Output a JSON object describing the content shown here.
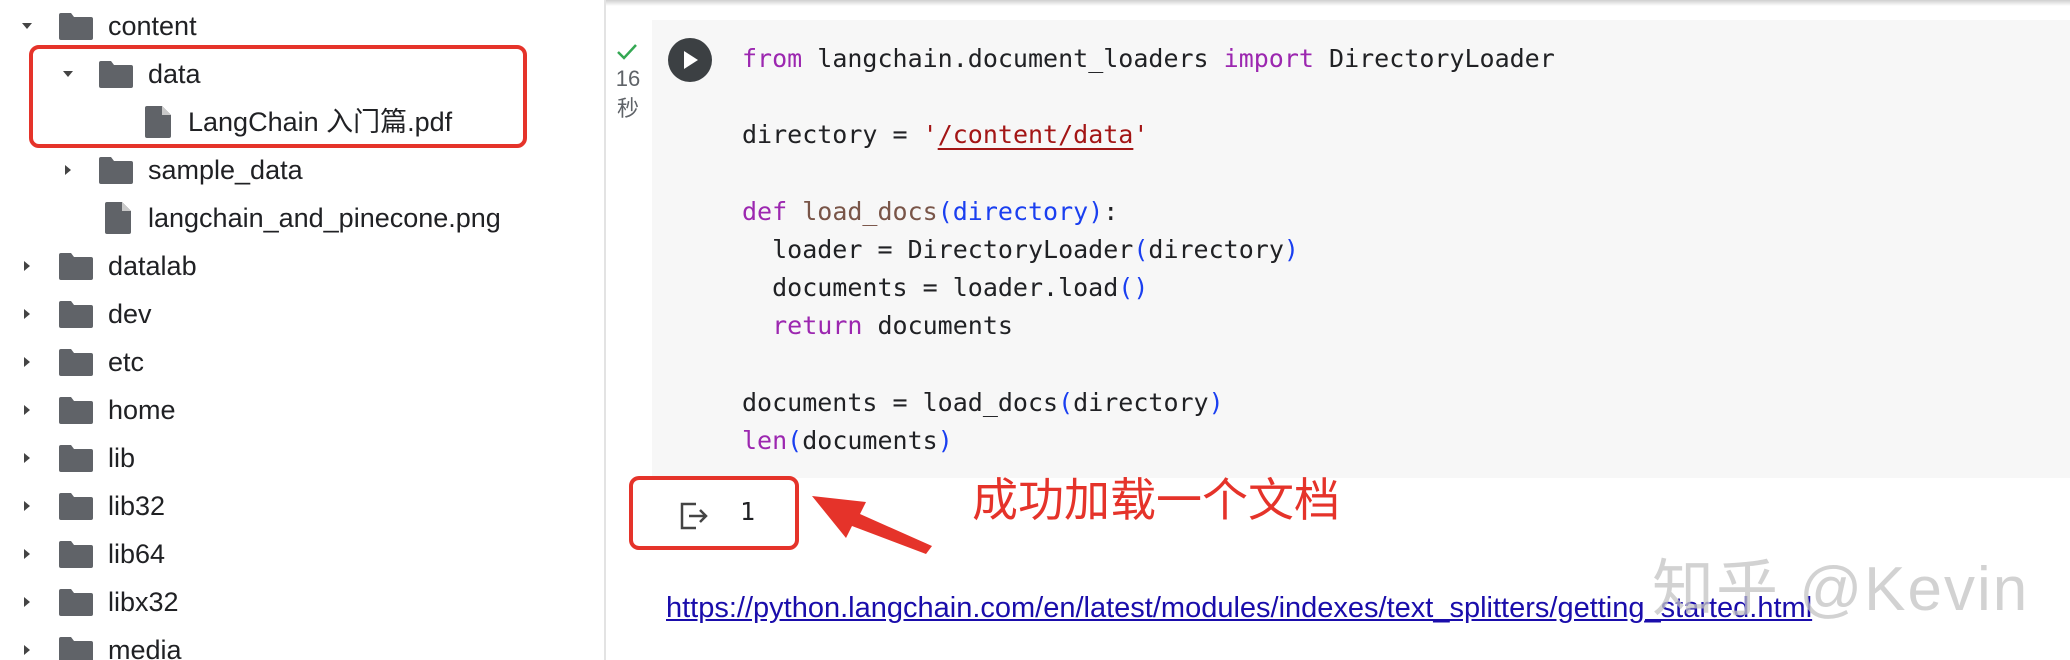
{
  "file_tree": {
    "items": [
      {
        "label": "content",
        "expanded": true,
        "type": "folder"
      },
      {
        "label": "data",
        "expanded": true,
        "type": "folder"
      },
      {
        "label": "LangChain 入门篇.pdf",
        "type": "file"
      },
      {
        "label": "sample_data",
        "expanded": false,
        "type": "folder"
      },
      {
        "label": "langchain_and_pinecone.png",
        "type": "file"
      },
      {
        "label": "datalab",
        "expanded": false,
        "type": "folder"
      },
      {
        "label": "dev",
        "expanded": false,
        "type": "folder"
      },
      {
        "label": "etc",
        "expanded": false,
        "type": "folder"
      },
      {
        "label": "home",
        "expanded": false,
        "type": "folder"
      },
      {
        "label": "lib",
        "expanded": false,
        "type": "folder"
      },
      {
        "label": "lib32",
        "expanded": false,
        "type": "folder"
      },
      {
        "label": "lib64",
        "expanded": false,
        "type": "folder"
      },
      {
        "label": "libx32",
        "expanded": false,
        "type": "folder"
      },
      {
        "label": "media",
        "expanded": false,
        "type": "folder"
      }
    ]
  },
  "cell": {
    "status_icon": "check-icon",
    "exec_time": "16\n秒",
    "code": {
      "l1_from": "from",
      "l1_module": " langchain.document_loaders ",
      "l1_import": "import",
      "l1_name": " DirectoryLoader",
      "l3_var": "directory = ",
      "l3_q1": "'",
      "l3_path": "/content/data",
      "l3_q2": "'",
      "l5_def": "def",
      "l5_space": " ",
      "l5_fn": "load_docs",
      "l5_open": "(",
      "l5_param": "directory",
      "l5_close": ")",
      "l5_colon": ":",
      "l6_a": "  loader = DirectoryLoader",
      "l6_open": "(",
      "l6_arg": "directory",
      "l6_close": ")",
      "l7_a": "  documents = loader.load",
      "l7_parens": "()",
      "l8_indent": "  ",
      "l8_return": "return",
      "l8_b": " documents",
      "l10_a": "documents = load_docs",
      "l10_open": "(",
      "l10_arg": "directory",
      "l10_close": ")",
      "l11_len": "len",
      "l11_open": "(",
      "l11_arg": "documents",
      "l11_close": ")"
    },
    "output": "1"
  },
  "annotation": {
    "text": "成功加载一个文档",
    "color": "#e5332a"
  },
  "link": {
    "text": "https://python.langchain.com/en/latest/modules/indexes/text_splitters/getting_started.html"
  },
  "watermark": "知乎 @Kevin"
}
